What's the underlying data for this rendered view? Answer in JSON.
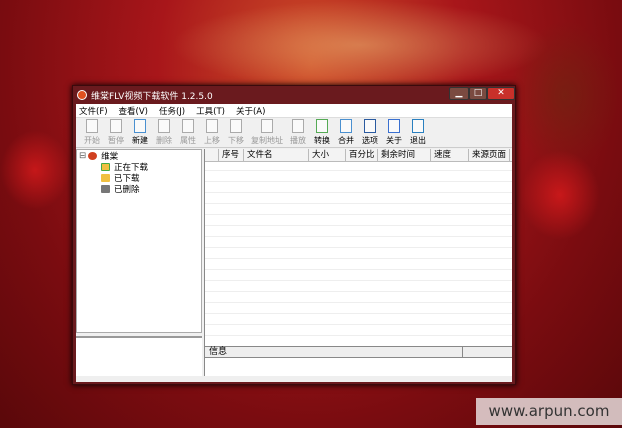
{
  "window": {
    "title": "维棠FLV视频下载软件 1.2.5.0",
    "minimize": "▁",
    "maximize": "□",
    "close": "✕"
  },
  "menu": [
    "文件(F)",
    "查看(V)",
    "任务(J)",
    "工具(T)",
    "关于(A)"
  ],
  "toolbar": [
    {
      "label": "开始",
      "enabled": false
    },
    {
      "label": "暂停",
      "enabled": false
    },
    {
      "label": "新建",
      "enabled": true
    },
    {
      "label": "删除",
      "enabled": false
    },
    {
      "label": "属性",
      "enabled": false
    },
    {
      "label": "上移",
      "enabled": false
    },
    {
      "label": "下移",
      "enabled": false
    },
    {
      "label": "复制地址",
      "enabled": false
    },
    {
      "label": "播放",
      "enabled": false
    },
    {
      "label": "转换",
      "enabled": true
    },
    {
      "label": "合并",
      "enabled": true
    },
    {
      "label": "选项",
      "enabled": true
    },
    {
      "label": "关于",
      "enabled": true
    },
    {
      "label": "退出",
      "enabled": true
    }
  ],
  "tree": {
    "root": "维棠",
    "expander": "⊟",
    "items": [
      "正在下载",
      "已下载",
      "已删除"
    ]
  },
  "list": {
    "columns": [
      "",
      "序号",
      "文件名",
      "大小",
      "百分比",
      "剩余时间",
      "速度",
      "来源页面"
    ]
  },
  "info": {
    "label": "信息"
  },
  "watermark": "www.arpun.com"
}
